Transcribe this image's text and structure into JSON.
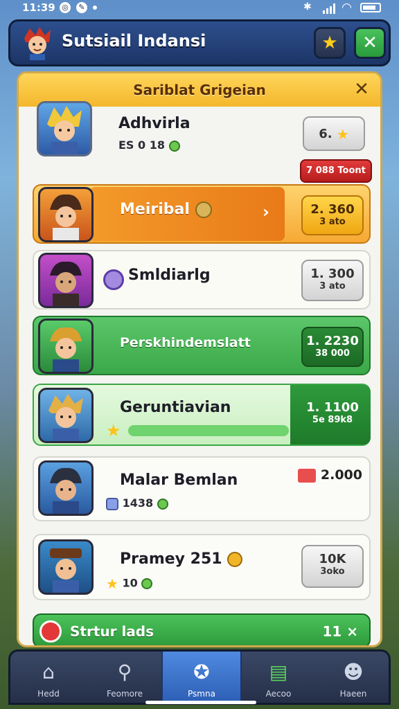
{
  "status_bar": {
    "time": "11:39"
  },
  "header": {
    "title": "Sutsiail Indansi"
  },
  "panel": {
    "title": "Sariblat Grigeian"
  },
  "rows": [
    {
      "name": "Adhvirla",
      "meta": "ES  0 18",
      "chip": [
        "6.",
        ""
      ],
      "style": "plain"
    },
    {
      "name": "Meiribal",
      "chip": [
        "2. 360",
        "3 ato"
      ],
      "style": "orange"
    },
    {
      "name": "Smldiarlg",
      "chip": [
        "1. 300",
        "3 ato"
      ],
      "style": "plain"
    },
    {
      "name": "Perskhindemslatt",
      "chip": [
        "1. 2230",
        "38 000"
      ],
      "style": "green"
    },
    {
      "name": "Geruntiavian",
      "chip": [
        "1. 1100",
        "5e 89k8"
      ],
      "style": "lightgreen"
    },
    {
      "name": "Malar Bemlan",
      "meta": "1438",
      "chip": [
        "2.000",
        ""
      ],
      "style": "plain"
    },
    {
      "name": "Pramey 251",
      "meta": "10",
      "chip": [
        "10K",
        "3oko"
      ],
      "style": "plain"
    }
  ],
  "red_tag": "7 088 Toont",
  "bottom_button": {
    "label": "Strtur lads",
    "right": "11 ×"
  },
  "nav": [
    {
      "label": "Hedd",
      "icon": "home-icon"
    },
    {
      "label": "Feomore",
      "icon": "search-icon"
    },
    {
      "label": "Psmna",
      "icon": "compass-icon"
    },
    {
      "label": "Aecoo",
      "icon": "cash-icon"
    },
    {
      "label": "Haeen",
      "icon": "profile-icon"
    }
  ],
  "colors": {
    "accent": "#f4b72c",
    "orange": "#f08a24",
    "green": "#3aa848",
    "nav_active": "#3d74cc"
  }
}
